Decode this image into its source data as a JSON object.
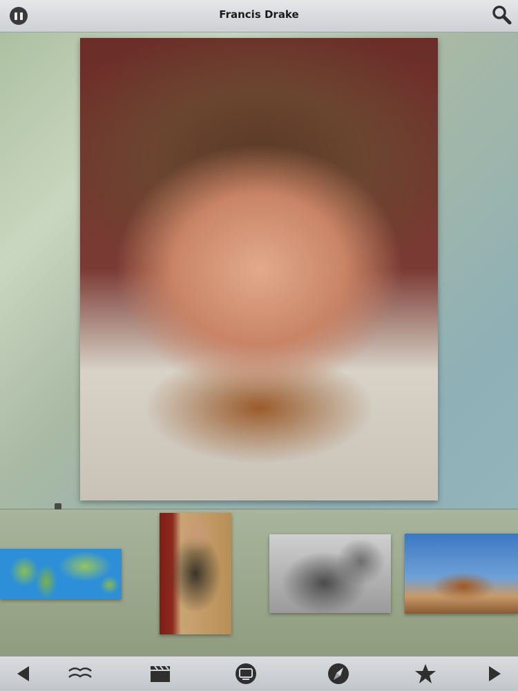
{
  "header": {
    "title": "Francis Drake",
    "pause_icon": "pause-icon",
    "search_icon": "search-icon"
  },
  "main_image": {
    "subject": "portrait",
    "icon": "image"
  },
  "timeline": {
    "position": 0.11
  },
  "thumbnails": [
    {
      "name": "world-map-thumbnail"
    },
    {
      "name": "painted-portrait-thumbnail"
    },
    {
      "name": "engraving-thumbnail"
    },
    {
      "name": "ship-thumbnail"
    }
  ],
  "toolbar": {
    "icons": [
      "previous-arrow-icon",
      "birds-icon",
      "clapperboard-icon",
      "screen-icon",
      "compass-icon",
      "star-icon",
      "next-arrow-icon"
    ]
  },
  "colors": {
    "bar": "#d0d3d7",
    "icon": "#2f2f2f"
  }
}
